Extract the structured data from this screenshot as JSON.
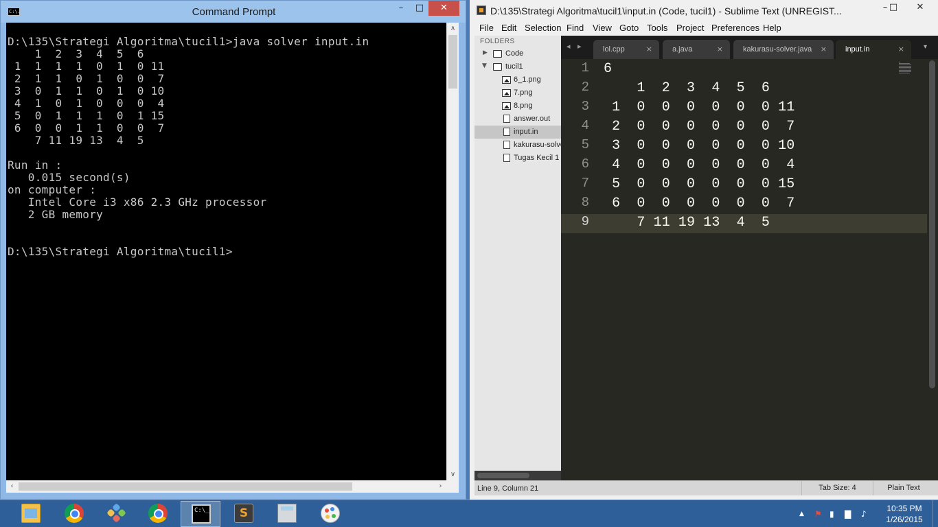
{
  "cmd": {
    "title": "Command Prompt",
    "app_icon_text": "C:\\.",
    "minimize": "–",
    "maximize": "□",
    "close": "✕",
    "output": "D:\\135\\Strategi Algoritma\\tucil1>java solver input.in\n    1  2  3  4  5  6\n 1  1  1  1  0  1  0 11\n 2  1  1  0  1  0  0  7\n 3  0  1  1  0  1  0 10\n 4  1  0  1  0  0  0  4\n 5  0  1  1  1  0  1 15\n 6  0  0  1  1  0  0  7\n    7 11 19 13  4  5\n\nRun in :\n   0.015 second(s)\non computer :\n   Intel Core i3 x86 2.3 GHz processor\n   2 GB memory\n\n\nD:\\135\\Strategi Algoritma\\tucil1>",
    "scroll_up": "∧",
    "scroll_down": "∨",
    "scroll_left": "‹",
    "scroll_right": "›"
  },
  "sublime": {
    "title": "D:\\135\\Strategi Algoritma\\tucil1\\input.in (Code, tucil1) - Sublime Text (UNREGIST...",
    "minimize": "–",
    "maximize": "□",
    "close": "✕",
    "menu": [
      "File",
      "Edit",
      "Selection",
      "Find",
      "View",
      "Goto",
      "Tools",
      "Project",
      "Preferences",
      "Help"
    ],
    "sidebar": {
      "heading": "FOLDERS",
      "items": [
        {
          "label": "Code",
          "type": "folder",
          "collapsed": true
        },
        {
          "label": "tucil1",
          "type": "folder",
          "collapsed": false
        },
        {
          "label": "6_1.png",
          "type": "image"
        },
        {
          "label": "7.png",
          "type": "image"
        },
        {
          "label": "8.png",
          "type": "image"
        },
        {
          "label": "answer.out",
          "type": "file"
        },
        {
          "label": "input.in",
          "type": "file",
          "selected": true
        },
        {
          "label": "kakurasu-solver.java",
          "type": "image"
        },
        {
          "label": "Tugas Kecil 1",
          "type": "file"
        }
      ]
    },
    "tab_nav": {
      "left": "◂",
      "right": "▸",
      "dropdown": "▾"
    },
    "tabs": [
      {
        "label": "lol.cpp",
        "close": "×"
      },
      {
        "label": "a.java",
        "close": "×"
      },
      {
        "label": "kakurasu-solver.java",
        "close": "×"
      },
      {
        "label": "input.in",
        "close": "×",
        "active": true
      }
    ],
    "editor_lines": [
      "6",
      "    1  2  3  4  5  6",
      " 1  0  0  0  0  0  0 11",
      " 2  0  0  0  0  0  0  7",
      " 3  0  0  0  0  0  0 10",
      " 4  0  0  0  0  0  0  4",
      " 5  0  0  0  0  0  0 15",
      " 6  0  0  0  0  0  0  7",
      "    7 11 19 13  4  5"
    ],
    "line_numbers": [
      "1",
      "2",
      "3",
      "4",
      "5",
      "6",
      "7",
      "8",
      "9"
    ],
    "current_line": 9,
    "status": {
      "position": "Line 9, Column 21",
      "tab_size": "Tab Size: 4",
      "syntax": "Plain Text"
    },
    "colors": {
      "editor_bg": "#272822",
      "text": "#f8f8f2",
      "gutter": "#8f908a"
    }
  },
  "taskbar": {
    "apps": [
      {
        "name": "file-explorer",
        "icon": "folder-icon"
      },
      {
        "name": "chrome",
        "icon": "chrome-icon"
      },
      {
        "name": "game",
        "icon": "game-icon"
      },
      {
        "name": "chrome-2",
        "icon": "chrome-icon"
      },
      {
        "name": "command-prompt",
        "icon": "cmd-icon",
        "active": true,
        "text": "C:\\_"
      },
      {
        "name": "sublime-text",
        "icon": "sublime-icon",
        "text": "S"
      },
      {
        "name": "calculator",
        "icon": "calculator-icon"
      },
      {
        "name": "paint",
        "icon": "paint-icon"
      }
    ],
    "tray": {
      "show_hidden": "▲",
      "flag": "⚑",
      "network": "▇",
      "volume": "♪"
    },
    "clock": {
      "time": "10:35 PM",
      "date": "1/26/2015"
    }
  }
}
